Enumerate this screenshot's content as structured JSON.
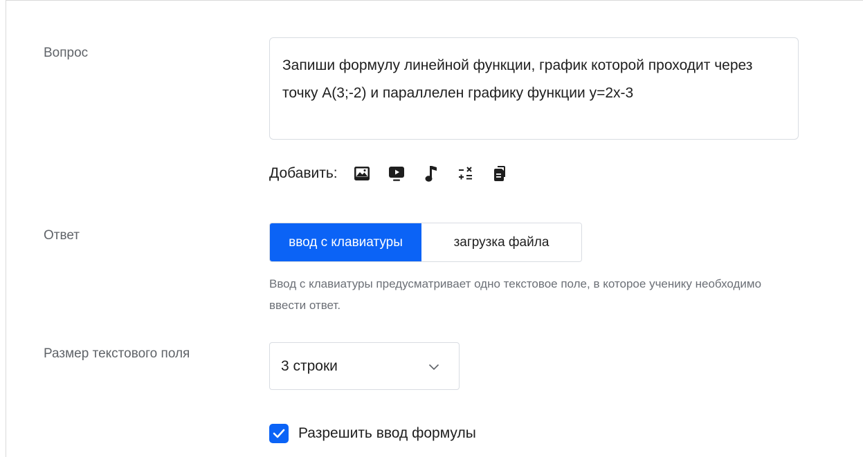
{
  "question": {
    "label": "Вопрос",
    "text": "Запиши формулу линейной функции, график которой проходит через точку А(3;-2) и параллелен графику функции у=2х-3",
    "add_label": "Добавить:",
    "tools": [
      "image-icon",
      "video-icon",
      "music-icon",
      "formula-icon",
      "file-icon"
    ]
  },
  "answer": {
    "label": "Ответ",
    "modes": [
      {
        "label": "ввод с клавиатуры",
        "selected": true
      },
      {
        "label": "загрузка файла",
        "selected": false
      }
    ],
    "hint": "Ввод с клавиатуры предусматривает одно текстовое поле, в которое ученику необходимо ввести ответ."
  },
  "text_size": {
    "label": "Размер текстового поля",
    "selected": "3 строки"
  },
  "formula_input": {
    "label": "Разрешить ввод формулы",
    "checked": true
  },
  "colors": {
    "accent": "#0b63f6",
    "muted_text": "#6b6f76",
    "border": "#d8dce2"
  }
}
